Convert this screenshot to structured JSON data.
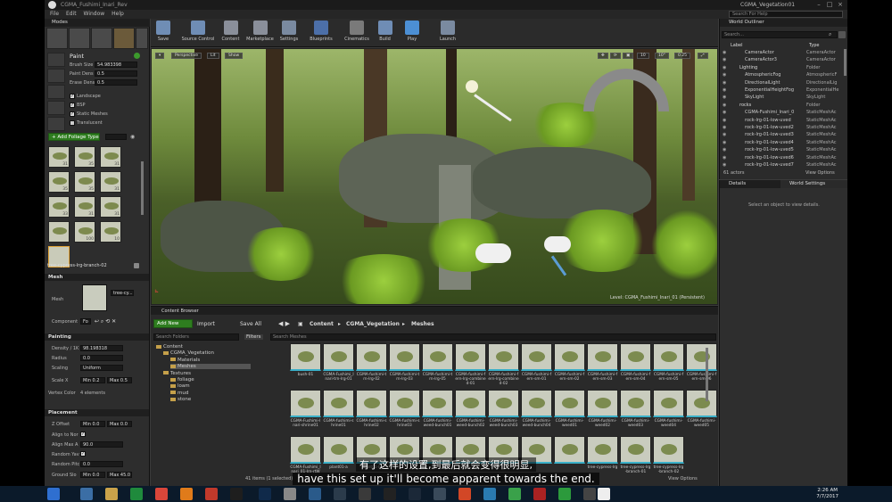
{
  "window": {
    "title": "CGMA_Fushimi_Inari_Rev",
    "project": "CGMA_Vegetation01",
    "search_help": "Search For Help"
  },
  "menu": [
    "File",
    "Edit",
    "Window",
    "Help"
  ],
  "modes": {
    "title": "Modes",
    "tool_title": "Paint",
    "brush_size_label": "Brush Size",
    "brush_size_value": "54.983398",
    "paint_density_label": "Paint Dens",
    "paint_density_value": "0.5",
    "erase_density_label": "Erase Dens",
    "erase_density_value": "0.5",
    "filters": [
      "Landscape",
      "BSP",
      "Static Meshes",
      "Translucent"
    ],
    "filters_checked": [
      true,
      true,
      true,
      false
    ],
    "add_foliage_label": "+ Add Foliage Type",
    "foliage_counts": [
      "31",
      "35",
      "31",
      "35",
      "35",
      "31",
      "33",
      "31",
      "31",
      "",
      "100",
      "10"
    ],
    "selected_foliage": "tree-cypress-lrg-branch-02",
    "mesh_section": "Mesh",
    "mesh_label": "Mesh",
    "mesh_value": "tree-cy...",
    "component_label": "Component",
    "component_value": "Fo",
    "painting_section": "Painting",
    "density_label": "Density / 1K",
    "density_value": "98.198318",
    "radius_label": "Radius",
    "radius_value": "0.0",
    "scaling_label": "Scaling",
    "scaling_value": "Uniform",
    "scale_x_label": "Scale X",
    "scale_min": "Min 0.2",
    "scale_max": "Max 0.5",
    "vertex_color_label": "Vertex Color",
    "vertex_color_value": "4 elements",
    "placement_section": "Placement",
    "z_offset_label": "Z Offset",
    "z_min": "Min 0.0",
    "z_max": "Max 0.0",
    "align_normal_label": "Align to Nor",
    "align_max_label": "Align Max A",
    "align_max_value": "90.0",
    "random_yaw_label": "Random Yav",
    "random_pitch_label": "Random Pitc",
    "random_pitch_value": "0.0",
    "ground_slope_label": "Ground Slo",
    "ground_min": "Min 0.0",
    "ground_max": "Max 45.0"
  },
  "toolbar": {
    "buttons": [
      "Save",
      "Source Control",
      "Content",
      "Marketplace",
      "Settings",
      "Blueprints",
      "Cinematics",
      "Build",
      "Play",
      "Launch"
    ],
    "colors": [
      "#6f8db5",
      "#6f8db5",
      "#8a8f9a",
      "#8a8f9a",
      "#7a8aa0",
      "#4c6fa8",
      "#7a7a7a",
      "#6f8db5",
      "#4c8fd4",
      "#7a8aa0"
    ]
  },
  "viewport": {
    "buttons": [
      "Perspective",
      "Lit",
      "Show"
    ],
    "level_label": "Level: CGMA_Fushimi_Inari_01 (Persistent)"
  },
  "outliner": {
    "tab": "World Outliner",
    "search_placeholder": "Search...",
    "col_label": "Label",
    "col_type": "Type",
    "rows": [
      {
        "name": "CameraActor",
        "type": "CameraActor"
      },
      {
        "name": "CameraActor3",
        "type": "CameraActor"
      },
      {
        "name": "Lighting",
        "type": "Folder"
      },
      {
        "name": "AtmosphericFog",
        "type": "AtmosphericF"
      },
      {
        "name": "DirectionalLight",
        "type": "DirectionalLig"
      },
      {
        "name": "ExponentialHeightFog",
        "type": "ExponentialHe"
      },
      {
        "name": "SkyLight",
        "type": "SkyLight"
      },
      {
        "name": "rocks",
        "type": "Folder"
      },
      {
        "name": "CGMA-Fushimi_Inari_0",
        "type": "StaticMeshAc"
      },
      {
        "name": "rock-lrg-01-low-uved",
        "type": "StaticMeshAc"
      },
      {
        "name": "rock-lrg-01-low-uved2",
        "type": "StaticMeshAc"
      },
      {
        "name": "rock-lrg-01-low-uved3",
        "type": "StaticMeshAc"
      },
      {
        "name": "rock-lrg-01-low-uved4",
        "type": "StaticMeshAc"
      },
      {
        "name": "rock-lrg-01-low-uved5",
        "type": "StaticMeshAc"
      },
      {
        "name": "rock-lrg-01-low-uved6",
        "type": "StaticMeshAc"
      },
      {
        "name": "rock-lrg-01-low-uved7",
        "type": "StaticMeshAc"
      }
    ],
    "actor_count": "61 actors",
    "view_options": "View Options"
  },
  "details": {
    "tab": "Details",
    "tab2": "World Settings",
    "empty": "Select an object to view details."
  },
  "content": {
    "tab": "Content Browser",
    "add_new": "Add New",
    "import": "Import",
    "save_all": "Save All",
    "path": [
      "Content",
      "CGMA_Vegetation",
      "Meshes"
    ],
    "search_folders": "Search Folders",
    "filters": "Filters",
    "search_meshes": "Search Meshes",
    "tree": [
      {
        "name": "Content",
        "depth": 0
      },
      {
        "name": "CGMA_Vegetation",
        "depth": 1
      },
      {
        "name": "Materials",
        "depth": 2
      },
      {
        "name": "Meshes",
        "depth": 2
      },
      {
        "name": "Textures",
        "depth": 1
      },
      {
        "name": "foliage",
        "depth": 2
      },
      {
        "name": "loam",
        "depth": 2
      },
      {
        "name": "mud",
        "depth": 2
      },
      {
        "name": "stone",
        "depth": 2
      }
    ],
    "tiles": [
      "bush-01",
      "CGMA-Fushimi_Inari-trn-lrg-01",
      "CGMA-fushimi-trn-lrg-02",
      "CGMA-fushimi-trn-lrg-03",
      "CGMA-fushimi-trn-lrg-05",
      "CGMA-fushimi-fern-lrg-combined-01",
      "CGMA-fushimi-fern-lrg-combined-02",
      "CGMA-fushimi-fern-sm-01",
      "CGMA-fushimi-fern-sm-02",
      "CGMA-fushimi-fern-sm-03",
      "CGMA-fushimi-fern-sm-04",
      "CGMA-fushimi-fern-sm-05",
      "CGMA-fushimi-fern-sm-06",
      "CGMA-Fushimi-Inari-shrine01",
      "CGMA-fushimi-shrine01",
      "CGMA-fushimi-shrine02",
      "CGMA-fushimi-shrine03",
      "CGMA-fushimi-weed-bunch01",
      "CGMA-fushimi-weed-bunch02",
      "CGMA-fushimi-weed-bunch03",
      "CGMA-fushimi-weed-bunch04",
      "CGMA-fushimi-weed01",
      "CGMA-fushimi-weed02",
      "CGMA-fushimi-weed03",
      "CGMA-fushimi-weed04",
      "CGMA-fushimi-weed05",
      "CGMA-Fushimi_Inari_01-lrn-rtW",
      "plant01-a",
      "plant01-b",
      "",
      "",
      "",
      "",
      "",
      "",
      "tree-cypress-lrg",
      "tree-cypress-lrg-branch-01",
      "tree-cypress-lrg-branch-02"
    ],
    "status": "41 items (1 selected)",
    "view_options": "View Options"
  },
  "subtitle": {
    "cn": "有了这样的设置,到最后就会变得很明显,",
    "en": "have this set up it'll become apparent towards the end."
  },
  "taskbar": {
    "time": "2:26 AM",
    "date": "7/7/2017"
  }
}
